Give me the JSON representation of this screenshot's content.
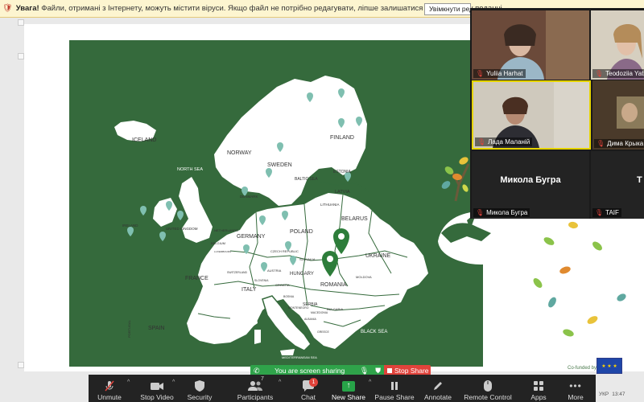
{
  "warning_bar": {
    "label": "Увага!",
    "text": "Файли, отримані з Інтернету, можуть містити віруси. Якщо файл не потрібно редагувати, ліпше залишатися в безпечному поданні.",
    "button_label": "Увімкнути редагування"
  },
  "slide": {
    "map_labels": {
      "iceland": "ICELAND",
      "north_sea": "NORTH SEA",
      "norway": "NORWAY",
      "sweden": "SWEDEN",
      "finland": "FINLAND",
      "baltic_sea": "BALTIC SEA",
      "estonia": "ESTONIA",
      "latvia": "LATVIA",
      "lithuania": "LITHUANIA",
      "denmark": "DENMARK",
      "ireland": "IRELAND",
      "united_kingdom": "UNITED KINGDOM",
      "netherlands": "NETHERLANDS",
      "belgium": "BELGIUM",
      "germany": "GERMANY",
      "poland": "POLAND",
      "belarus": "BELARUS",
      "czech": "CZECH REPUBLIC",
      "slovakia": "SLOVAKIA",
      "ukraine": "UKRAINE",
      "austria": "AUSTRIA",
      "hungary": "HUNGARY",
      "france": "FRANCE",
      "switzerland": "SWITZERLAND",
      "moldova": "MOLDOVA",
      "romania": "ROMANIA",
      "slovenia": "SLOVENIA",
      "croatia": "CROATIA",
      "serbia": "SERBIA",
      "italy": "ITALY",
      "bulgaria": "BULGARIA",
      "spain": "SPAIN",
      "portugal": "PORTUGAL",
      "black_sea": "BLACK SEA",
      "mediterranean": "MEDITERRANEAN SEA",
      "greece": "GREECE",
      "albania": "ALBANIA",
      "macedonia": "MACEDONIA",
      "montenegro": "MONTENEGRO",
      "bosnia": "BOSNIA",
      "luxembourg": "LUXEMBOURG"
    },
    "cofunded_text": "Co-funded by",
    "eu_stars": "★ ★ ★"
  },
  "gallery": {
    "participants": [
      {
        "name": "Yuliia Harhat",
        "muted": true
      },
      {
        "name": "Teodoziia Yatsk",
        "muted": true
      },
      {
        "name": "Лада Маланій",
        "muted": true,
        "active": true
      },
      {
        "name": "Дима Крыка",
        "muted": true
      },
      {
        "name": "Микола Бугра",
        "muted": true
      },
      {
        "name": "TAIF",
        "muted": true
      }
    ],
    "big_name": "Микола Бугра",
    "big_letter": "T"
  },
  "sharing": {
    "status": "You are screen sharing",
    "stop_label": "Stop Share"
  },
  "toolbar": {
    "unmute": "Unmute",
    "stop_video": "Stop Video",
    "security": "Security",
    "participants": "Participants",
    "participants_count": "7",
    "chat": "Chat",
    "chat_badge": "1",
    "new_share": "New Share",
    "pause_share": "Pause Share",
    "annotate": "Annotate",
    "remote_control": "Remote Control",
    "apps": "Apps",
    "more": "More"
  },
  "tray": {
    "lang": "УКР",
    "time": "13:47"
  },
  "colors": {
    "map_green": "#356a3c",
    "country_white": "#ffffff",
    "pin_teal": "#7fbfb0",
    "pin_green": "#2d7d3a",
    "share_green": "#2fa34a",
    "stop_red": "#e0433b"
  }
}
